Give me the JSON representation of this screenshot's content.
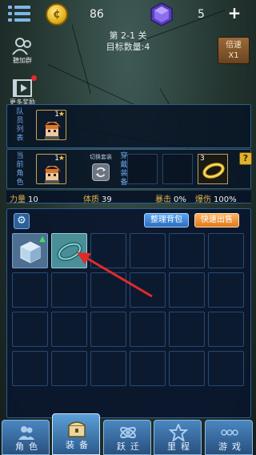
{
  "resources": {
    "coin_value": "86",
    "coin_symbol": "¢",
    "gem_value": "5",
    "add_label": "+"
  },
  "stage": {
    "title": "第 2-1 关",
    "target": "目标数量:4"
  },
  "speed_button": {
    "line1": "倍速",
    "line2": "X1"
  },
  "side_menu": [
    {
      "label": "聽加群",
      "icon": "group-icon"
    },
    {
      "label": "更多奖励",
      "icon": "reward-video-icon"
    }
  ],
  "team": {
    "label": "队员列表",
    "member_level": "1"
  },
  "current": {
    "label": "当前角色",
    "level": "1",
    "switch_label": "切换套装",
    "wear_label": "穿戴装备",
    "ring_count": "3",
    "help_label": "?"
  },
  "stats": [
    {
      "name": "力量",
      "value": "10"
    },
    {
      "name": "体质",
      "value": "39"
    },
    {
      "name": "暴击",
      "value": "0%"
    },
    {
      "name": "爆伤",
      "value": "100%"
    }
  ],
  "bag": {
    "sort_label": "整理背包",
    "sell_label": "快速出售",
    "settings_icon": "gear-icon"
  },
  "bottom_nav": [
    {
      "label": "角色",
      "icon": "characters-icon"
    },
    {
      "label": "装备",
      "icon": "chest-icon",
      "active": true
    },
    {
      "label": "跃迁",
      "icon": "warp-icon"
    },
    {
      "label": "里程",
      "icon": "star-icon"
    },
    {
      "label": "游戏",
      "icon": "more-icon"
    }
  ],
  "colors": {
    "panel_border": "#2f5d8a",
    "label_blue": "#6fa8ee",
    "stat_gold": "#e0b24a",
    "arrow_red": "#e02a2a"
  }
}
